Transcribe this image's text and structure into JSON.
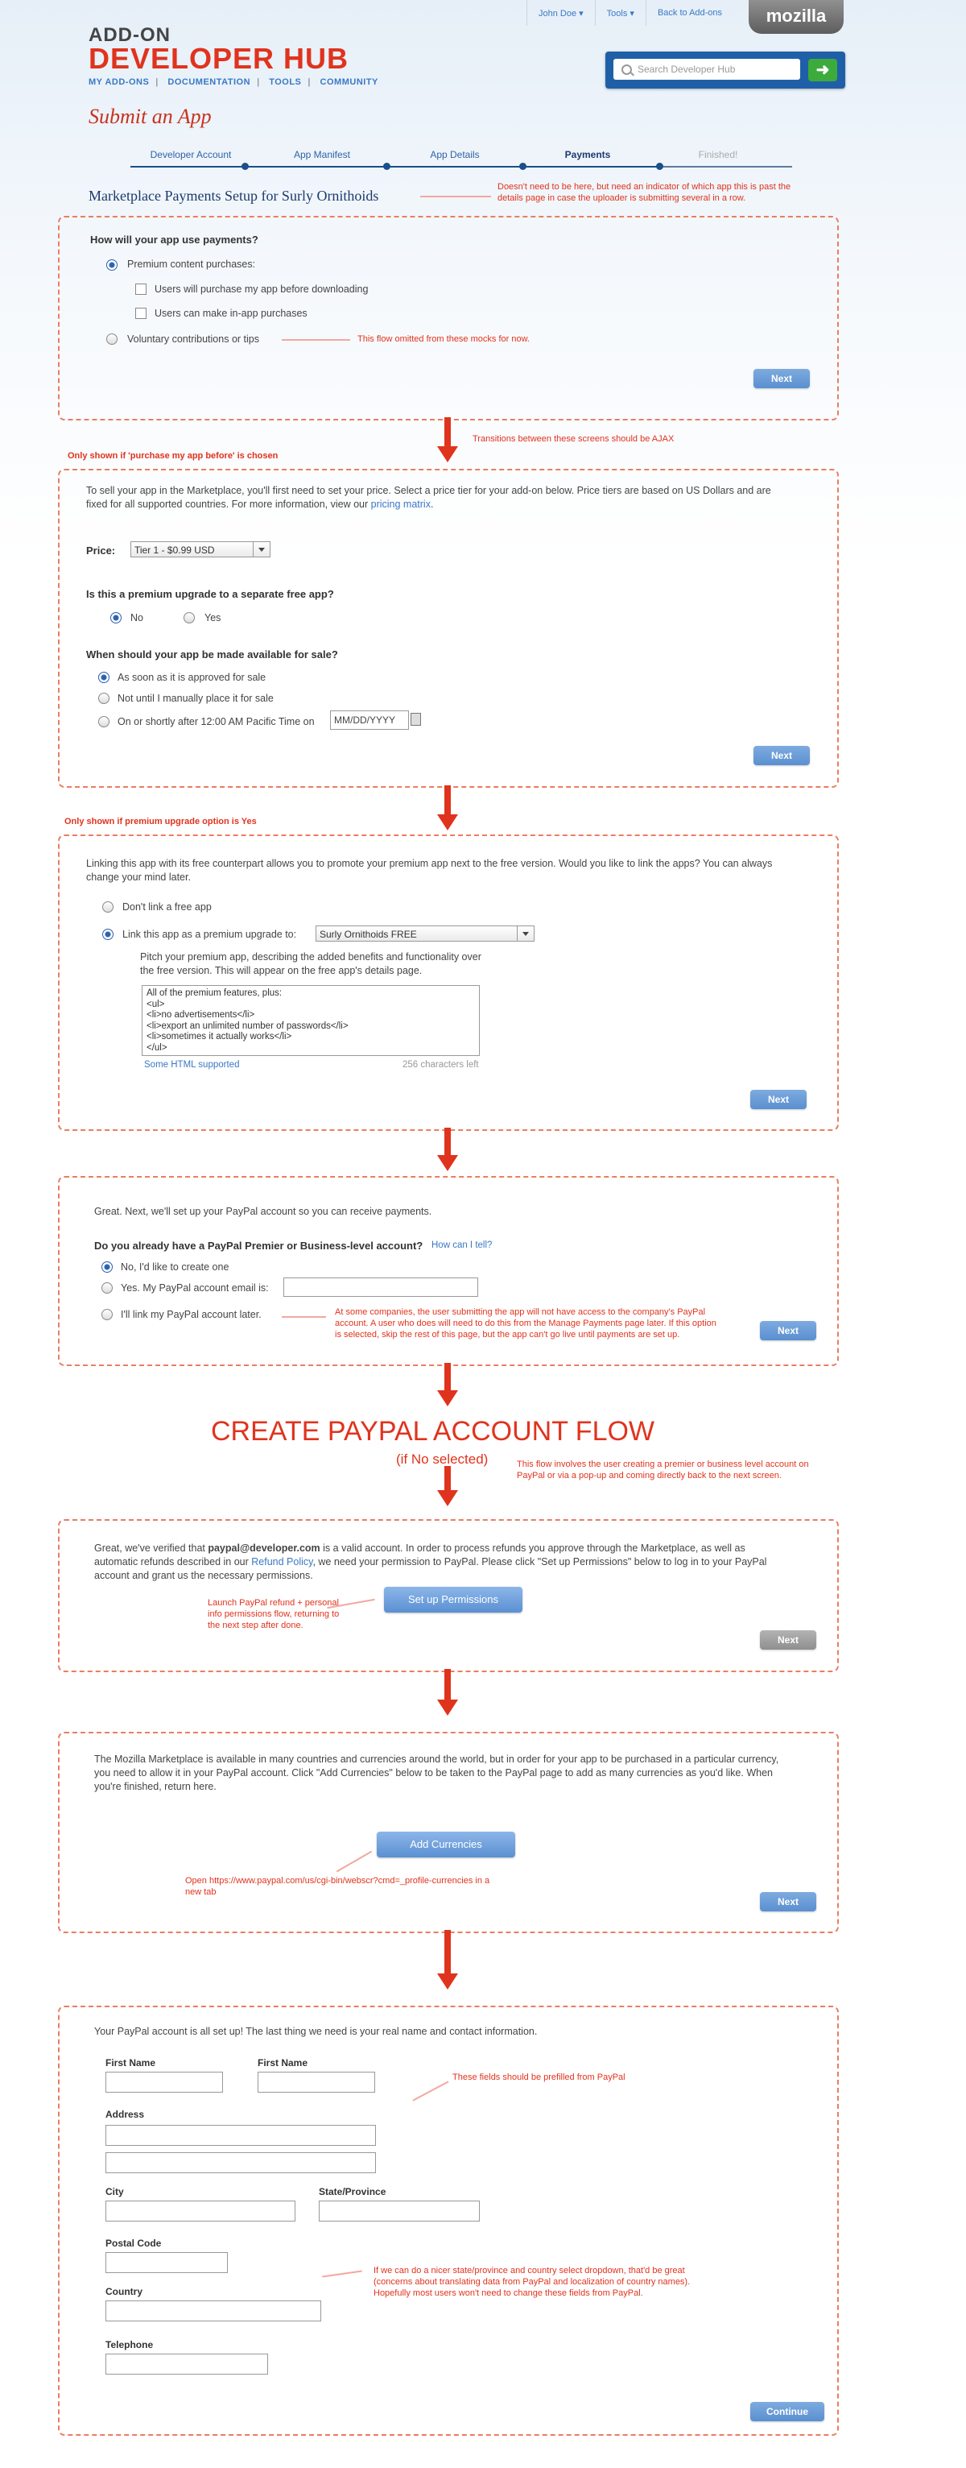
{
  "header": {
    "brand_top": "ADD-ON",
    "brand_main": "DEVELOPER HUB",
    "nav": [
      "MY ADD-ONS",
      "DOCUMENTATION",
      "TOOLS",
      "COMMUNITY"
    ],
    "topnav": {
      "user": "John Doe",
      "tools": "Tools",
      "back": "Back to Add-ons"
    },
    "logo": "mozilla",
    "search_placeholder": "Search Developer Hub"
  },
  "page_title": "Submit an App",
  "steps": [
    "Developer Account",
    "App Manifest",
    "App Details",
    "Payments",
    "Finished!"
  ],
  "app_subtitle": "Marketplace Payments Setup for Surly Ornithoids",
  "notes": {
    "subtitle": "Doesn't need to be here, but need an indicator of which app this is past the details page in case the uploader is submitting several in a row.",
    "voluntary": "This flow omitted from these mocks for now.",
    "ajax": "Transitions between these screens should be AJAX",
    "only_purchase": "Only shown if 'purchase my app before' is chosen",
    "only_upgrade": "Only shown if premium upgrade option is Yes",
    "link_later": "At some companies, the user submitting the app will not have access to the company's PayPal account. A user who does will need to do this from the Manage Payments page later. If this option is selected, skip the  rest of this page, but the app can't go live until payments are set up.",
    "create_flow_title": "CREATE PAYPAL ACCOUNT FLOW",
    "create_flow_sub": "(if No selected)",
    "create_flow_desc": "This flow involves the user creating a premier or business level account on PayPal or via a pop-up and coming directly back to the next screen.",
    "launch_refund": "Launch PayPal refund + personal info permissions flow, returning to the next step after done.",
    "open_url": "Open https://www.paypal.com/us/cgi-bin/webscr?cmd=_profile-currencies in a new tab",
    "prefilled": "These fields should be prefilled from PayPal",
    "dropdown": "If we can do a nicer state/province and country select dropdown, that'd be great (concerns about translating data from PayPal and localization of country names). Hopefully most users won't need to change these fields from PayPal."
  },
  "panel1": {
    "question": "How will your app use payments?",
    "premium": "Premium content purchases:",
    "purchase_before": "Users will purchase my app before downloading",
    "in_app": "Users can make in-app purchases",
    "voluntary": "Voluntary contributions or tips",
    "next": "Next"
  },
  "panel2": {
    "intro_a": "To sell your app in the Marketplace, you'll first need to set your price. Select a price tier for your add-on below. Price tiers are based on US Dollars and are fixed for all supported countries. For more information, view our ",
    "intro_link": "pricing matrix",
    "intro_b": ".",
    "price_label": "Price:",
    "price_value": "Tier 1 - $0.99 USD",
    "upgrade_q": "Is this a premium upgrade to a separate free app?",
    "no": "No",
    "yes": "Yes",
    "avail_q": "When should your app be made available for sale?",
    "opt1": "As soon as it is approved for sale",
    "opt2": "Not until I manually place it for sale",
    "opt3": "On or shortly after 12:00 AM Pacific Time on",
    "date_placeholder": "MM/DD/YYYY",
    "next": "Next"
  },
  "panel3": {
    "intro": "Linking this app with its free counterpart allows you to promote your premium app next to the free version. Would you like to link the apps? You can always change your mind later.",
    "dont_link": "Don't link a free app",
    "link_as": "Link this app as a premium upgrade to:",
    "app_select": "Surly Ornithoids FREE",
    "pitch": "Pitch your premium app, describing the added benefits and functionality over the free version. This will appear on the free app's details page.",
    "textarea": [
      "All of the premium features, plus:",
      "<ul>",
      "<li>no advertisements</li>",
      "<li>export an unlimited number of passwords</li>",
      "<li>sometimes it actually works</li>",
      "</ul>"
    ],
    "html_supported": "Some HTML supported",
    "chars_left": "256 characters left",
    "next": "Next"
  },
  "panel4": {
    "intro": "Great. Next, we'll set up your PayPal account so you can receive payments.",
    "question": "Do you already have a PayPal Premier or Business-level account?",
    "how_tell": "How can I tell?",
    "no_create": "No, I'd like to create one",
    "yes_email": "Yes. My PayPal account email is:",
    "link_later": "I'll link my PayPal account later.",
    "next": "Next"
  },
  "panel5": {
    "intro_a": "Great, we've verified that ",
    "email": "paypal@developer.com",
    "intro_b": " is a valid account. In order to process refunds you approve through the Marketplace, as well as automatic refunds described in our ",
    "refund_link": "Refund Policy",
    "intro_c": ", we need your permission to PayPal. Please click \"Set up Permissions\" below to log in to your PayPal account and grant us the necessary permissions.",
    "setup_btn": "Set up Permissions",
    "next": "Next"
  },
  "panel6": {
    "intro": "The Mozilla Marketplace is available in many countries and currencies around the world, but in order for your app to be purchased in a particular currency, you need to allow it in your PayPal account. Click \"Add Currencies\" below to be taken to the PayPal page to add as many currencies as you'd like. When you're finished, return here.",
    "add_btn": "Add Currencies",
    "next": "Next"
  },
  "panel7": {
    "intro": "Your PayPal account is all set up! The last thing we need is your real name and contact information.",
    "first_name": "First Name",
    "first_name_2": "First Name",
    "address": "Address",
    "city": "City",
    "state": "State/Province",
    "postal": "Postal Code",
    "country": "Country",
    "telephone": "Telephone",
    "continue": "Continue"
  }
}
